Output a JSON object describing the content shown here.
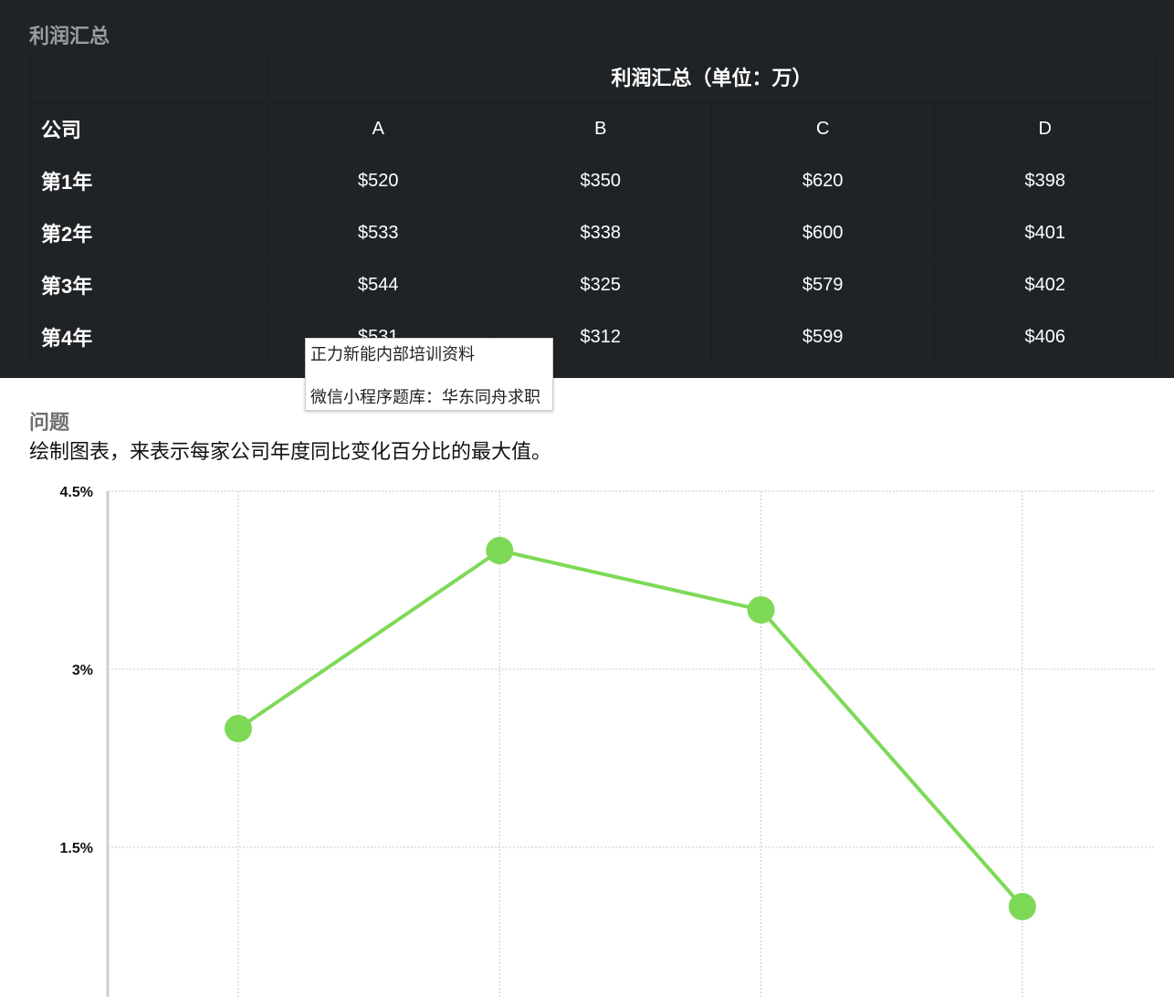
{
  "panel": {
    "title": "利润汇总"
  },
  "table": {
    "header": "利润汇总（单位：万）",
    "row_header": "公司",
    "columns": [
      "A",
      "B",
      "C",
      "D"
    ],
    "rows": [
      {
        "label": "第1年",
        "values": [
          "$520",
          "$350",
          "$620",
          "$398"
        ]
      },
      {
        "label": "第2年",
        "values": [
          "$533",
          "$338",
          "$600",
          "$401"
        ]
      },
      {
        "label": "第3年",
        "values": [
          "$544",
          "$325",
          "$579",
          "$402"
        ]
      },
      {
        "label": "第4年",
        "values": [
          "$531",
          "$312",
          "$599",
          "$406"
        ]
      }
    ]
  },
  "tooltip": {
    "line1": "正力新能内部培训资料",
    "line2": "微信小程序题库：华东同舟求职"
  },
  "question": {
    "title": "问题",
    "text": "绘制图表，来表示每家公司年度同比变化百分比的最大值。"
  },
  "colors": {
    "panel_bg": "#202326",
    "series_line": "#7ed957",
    "series_point": "#7ed957"
  },
  "chart_data": {
    "type": "line",
    "y_ticks": [
      {
        "value": 4.5,
        "label": "4.5%"
      },
      {
        "value": 3,
        "label": "3%"
      },
      {
        "value": 1.5,
        "label": "1.5%"
      }
    ],
    "ylim": [
      0.3,
      4.5
    ],
    "x": [
      1,
      2,
      3,
      4
    ],
    "xlim": [
      0.5,
      4.5
    ],
    "series": [
      {
        "values": [
          2.5,
          4.0,
          3.5,
          1.0
        ]
      }
    ],
    "grid": true
  }
}
